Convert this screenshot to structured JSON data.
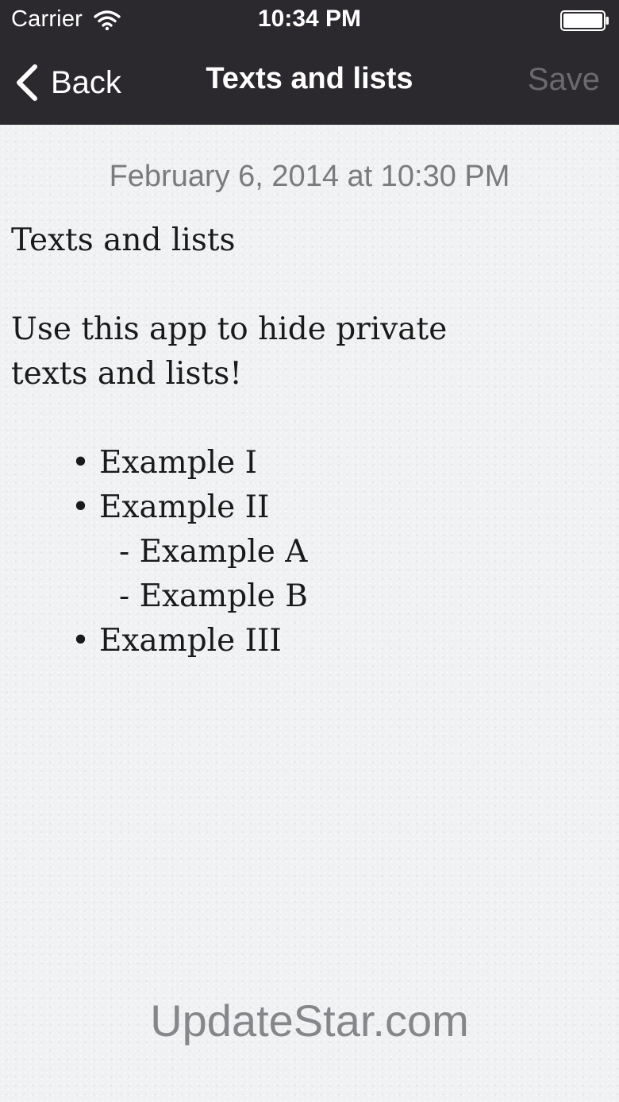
{
  "status_bar": {
    "carrier": "Carrier",
    "time": "10:34 PM",
    "icons": [
      "wifi-icon",
      "battery-icon"
    ]
  },
  "nav_bar": {
    "back_label": "Back",
    "back_icon": "chevron-left-icon",
    "title": "Texts and lists",
    "save_label": "Save"
  },
  "note": {
    "timestamp": "February 6, 2014 at 10:30 PM",
    "title_line": "Texts and lists",
    "intro_line_1": "Use this app to hide private",
    "intro_line_2": "texts and lists!",
    "bullet_glyph": "•",
    "sub_item_prefix": "- ",
    "items": [
      "Example I",
      "Example II",
      "Example A",
      "Example B",
      "Example III"
    ]
  },
  "watermark": "UpdateStar.com",
  "colors": {
    "nav_background": "#2b292e",
    "paper_background": "#eff1f2",
    "save_disabled": "#6c6a6f",
    "timestamp_text": "#7b7b7e"
  }
}
